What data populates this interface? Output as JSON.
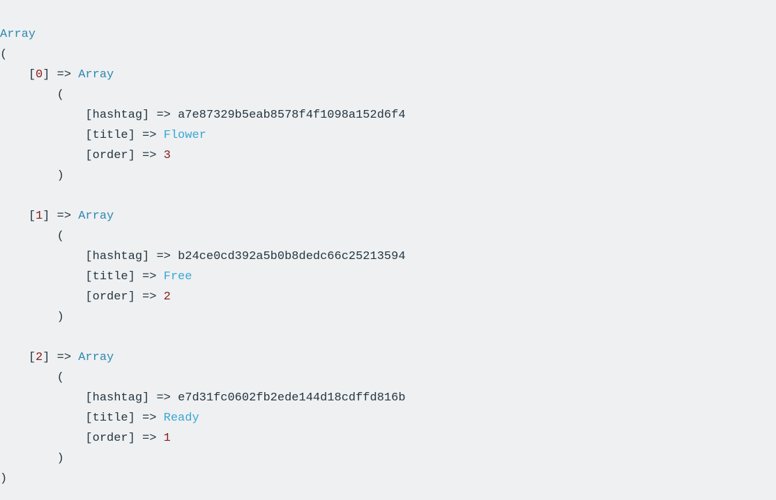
{
  "output": {
    "kind": "php-print_r",
    "root_keyword": "Array",
    "open_paren": "(",
    "close_paren": ")",
    "arrow": "=>",
    "bracket_open": "[",
    "bracket_close": "]",
    "key_labels": {
      "hashtag": "hashtag",
      "title": "title",
      "order": "order"
    },
    "items": [
      {
        "index": "0",
        "keyword": "Array",
        "hashtag": "a7e87329b5eab8578f4f1098a152d6f4",
        "title": "Flower",
        "order": "3"
      },
      {
        "index": "1",
        "keyword": "Array",
        "hashtag": "b24ce0cd392a5b0b8dedc66c25213594",
        "title": "Free",
        "order": "2"
      },
      {
        "index": "2",
        "keyword": "Array",
        "hashtag": "e7d31fc0602fb2ede144d18cdffd816b",
        "title": "Ready",
        "order": "1"
      }
    ]
  },
  "colors": {
    "background": "#eef0f2",
    "keyword": "#3089b0",
    "punctuation": "#253640",
    "number": "#8b1a1a",
    "string": "#3ba6d4"
  }
}
